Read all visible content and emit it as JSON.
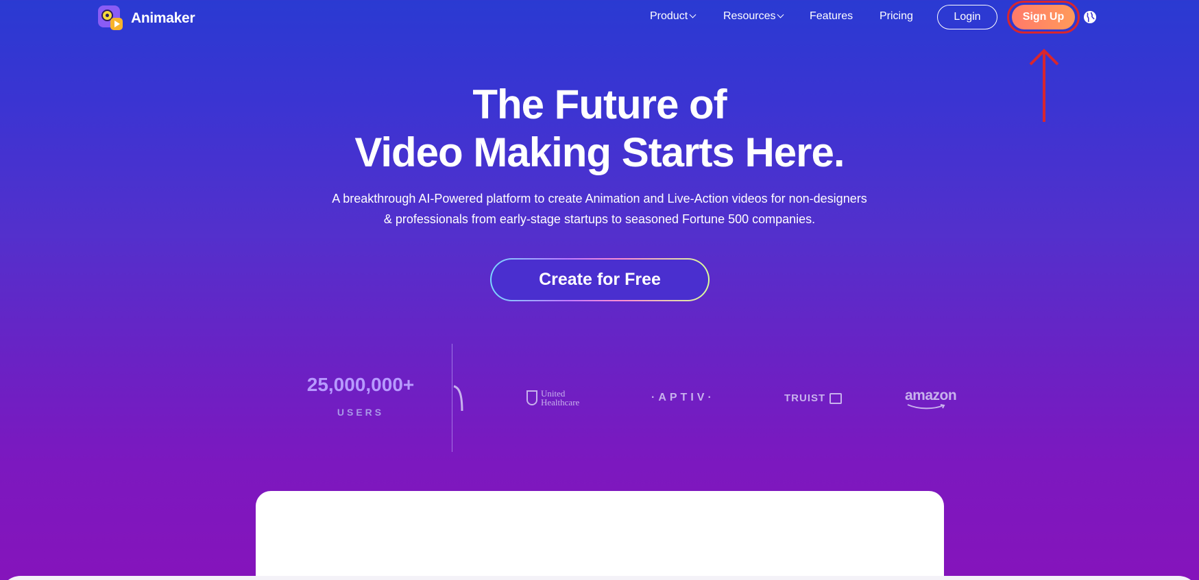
{
  "brand": {
    "name": "Animaker"
  },
  "nav": {
    "items": [
      {
        "label": "Product",
        "has_dropdown": true
      },
      {
        "label": "Resources",
        "has_dropdown": true
      },
      {
        "label": "Features",
        "has_dropdown": false
      },
      {
        "label": "Pricing",
        "has_dropdown": false
      }
    ],
    "login_label": "Login",
    "signup_label": "Sign Up",
    "language_icon": "globe-icon"
  },
  "annotation": {
    "highlight_color": "#d8262e",
    "arrow_color": "#d8262e"
  },
  "hero": {
    "title_line1": "The Future of",
    "title_line2": "Video Making Starts Here.",
    "subtitle_line1": "A breakthrough AI-Powered platform to create Animation and Live-Action videos for non-designers",
    "subtitle_line2": "& professionals from early-stage startups to seasoned Fortune 500 companies.",
    "cta_label": "Create for Free"
  },
  "stats": {
    "users_count": "25,000,000+",
    "users_label": "USERS"
  },
  "trusted_by": {
    "uhc_line1": "United",
    "uhc_line2": "Healthcare",
    "aptiv": "·APTIV·",
    "truist": "TRUIST",
    "amazon": "amazon"
  },
  "colors": {
    "background_top": "#2a3ad2",
    "background_bottom": "#8514bb",
    "signup_bg": "#ff8a62",
    "stat_color": "#b79aff"
  }
}
